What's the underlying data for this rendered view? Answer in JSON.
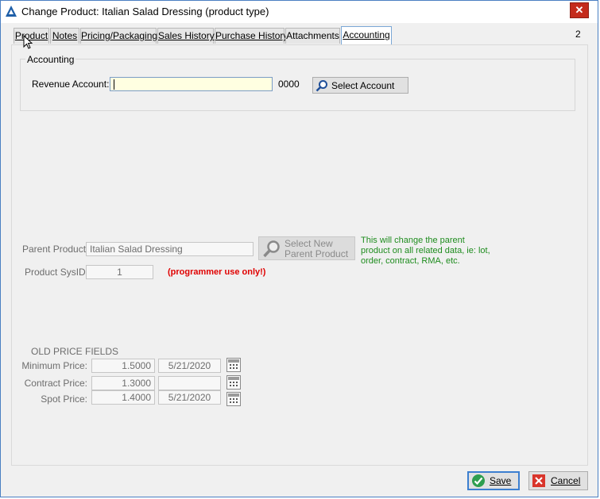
{
  "window": {
    "title": "Change Product: Italian Salad Dressing (product type)",
    "app_icon": "app-logo-icon",
    "close_label": "✕"
  },
  "tabs": [
    {
      "label": "Product",
      "active": false
    },
    {
      "label": "Notes",
      "active": false
    },
    {
      "label": "Pricing/Packaging",
      "active": false
    },
    {
      "label": "Sales History",
      "active": false
    },
    {
      "label": "Purchase History",
      "active": false
    },
    {
      "label": "Attachments",
      "active": false
    },
    {
      "label": "Accounting",
      "active": true
    }
  ],
  "page_number": "2",
  "accounting": {
    "group_label": "Accounting",
    "revenue_label": "Revenue Account:",
    "revenue_value": "",
    "revenue_code": "0000",
    "select_button": "Select Account"
  },
  "parent": {
    "parent_label": "Parent Product:",
    "parent_value": "Italian Salad Dressing",
    "select_parent_line1": "Select New",
    "select_parent_line2": "Parent Product",
    "note": "This will change the parent product on all related data, ie: lot, order, contract, RMA, etc.",
    "sysid_label": "Product SysID:",
    "sysid_value": "1",
    "programmer_note": "(programmer use only!)"
  },
  "old_prices": {
    "title": "OLD PRICE FIELDS",
    "rows": [
      {
        "label": "Minimum Price:",
        "value": "1.5000",
        "date": "5/21/2020"
      },
      {
        "label": "Contract Price:",
        "value": "1.3000",
        "date": ""
      },
      {
        "label": "Spot Price:",
        "value": "1.4000",
        "date": "5/21/2020"
      }
    ],
    "calendar_caption": "simple"
  },
  "footer": {
    "save_label": "Save",
    "cancel_label": "Cancel"
  },
  "colors": {
    "accent": "#3c7fd0",
    "note_green": "#1e8c1e",
    "warning_red": "#e00000",
    "input_yellow": "#ffffe1"
  }
}
